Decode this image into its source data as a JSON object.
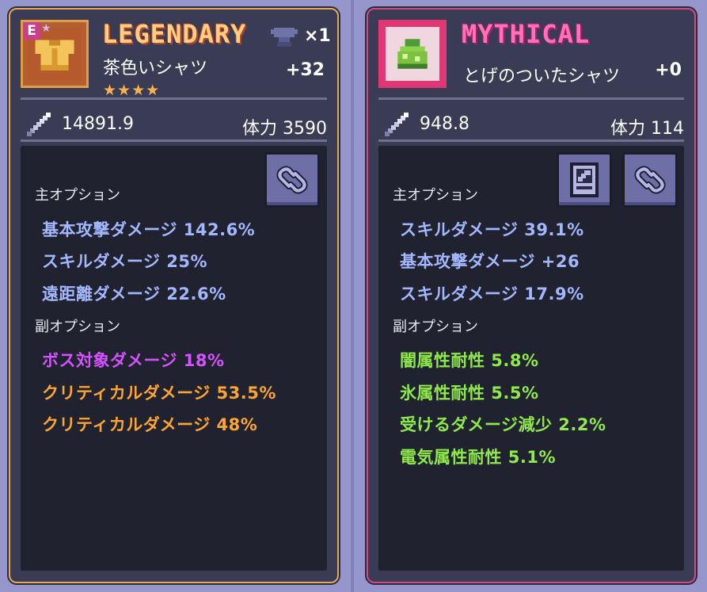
{
  "left": {
    "badge": "E",
    "rarity": "LEGENDARY",
    "count": "×1",
    "name": "茶色いシャツ",
    "plus": "+32",
    "stars": "★★★★",
    "attack": "14891.9",
    "hp_label": "体力",
    "hp_value": "3590",
    "main_label": "主オプション",
    "main": [
      {
        "text": "基本攻撃ダメージ  142.6%"
      },
      {
        "text": "スキルダメージ  25%"
      },
      {
        "text": "遠距離ダメージ  22.6%"
      }
    ],
    "sub_label": "副オプション",
    "sub": [
      {
        "text": "ボス対象ダメージ  18%",
        "color": "#d553ff"
      },
      {
        "text": "クリティカルダメージ  53.5%",
        "color": "#ffa531"
      },
      {
        "text": "クリティカルダメージ  48%",
        "color": "#ffa531"
      }
    ],
    "link_icon": "chain-link-icon"
  },
  "right": {
    "rarity": "MYTHICAL",
    "name": "とげのついたシャツ",
    "plus": "+0",
    "attack": "948.8",
    "hp_label": "体力",
    "hp_value": "114",
    "main_label": "主オプション",
    "main": [
      {
        "text": "スキルダメージ  39.1%"
      },
      {
        "text": "基本攻撃ダメージ  +26"
      },
      {
        "text": "スキルダメージ  17.9%"
      }
    ],
    "sub_label": "副オプション",
    "sub": [
      {
        "text": "闇属性耐性  5.8%"
      },
      {
        "text": "氷属性耐性  5.5%"
      },
      {
        "text": "受けるダメージ減少  2.2%"
      },
      {
        "text": "電気属性耐性  5.1%"
      }
    ],
    "doc_icon": "equipment-info-icon",
    "link_icon": "chain-link-icon"
  },
  "colors": {
    "legendary_border": "#e8a855",
    "mythical_border": "#d04a86",
    "main_option": "#a3b7ff",
    "sub_green": "#8fe94a"
  }
}
